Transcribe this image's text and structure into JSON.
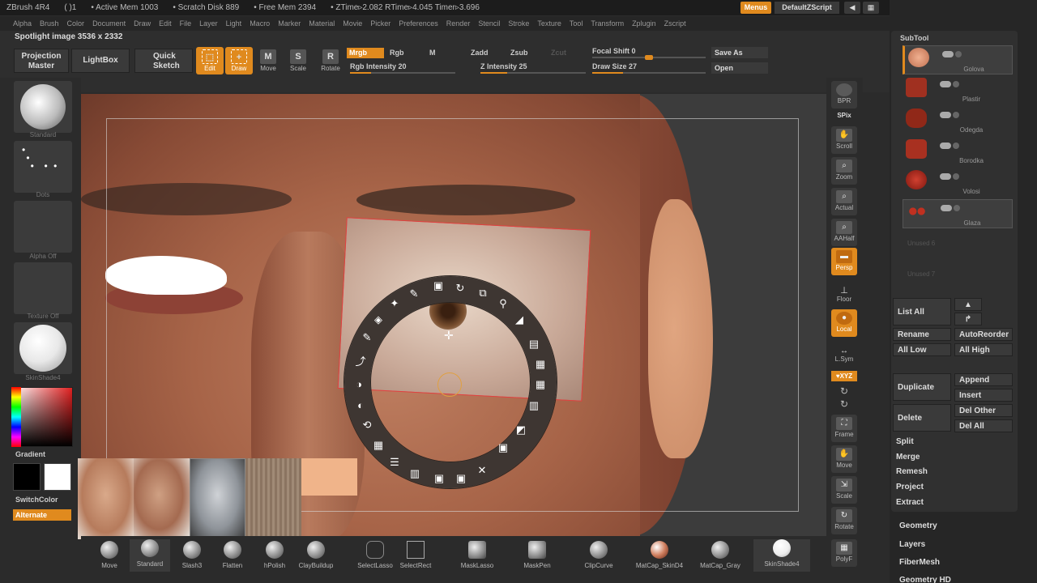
{
  "titlebar": {
    "app": "ZBrush 4R4",
    "paren": "( )1",
    "active_mem": "• Active Mem 1003",
    "scratch": "• Scratch Disk 889",
    "free_mem": "• Free Mem 2394",
    "ztime": "• ZTime▹2.082 RTime▹4.045 Timer▹3.696",
    "menus": "Menus",
    "default_script": "DefaultZScript"
  },
  "menubar": [
    "Alpha",
    "Brush",
    "Color",
    "Document",
    "Draw",
    "Edit",
    "File",
    "Layer",
    "Light",
    "Macro",
    "Marker",
    "Material",
    "Movie",
    "Picker",
    "Preferences",
    "Render",
    "Stencil",
    "Stroke",
    "Texture",
    "Tool",
    "Transform",
    "Zplugin",
    "Zscript"
  ],
  "toolbar": {
    "spotlight": "Spotlight image 3536 x 2332",
    "projection_master": "Projection Master",
    "lightbox": "LightBox",
    "quick_sketch": "Quick Sketch",
    "edit": "Edit",
    "draw": "Draw",
    "move": "Move",
    "scale": "Scale",
    "rotate": "Rotate",
    "mrgb": "Mrgb",
    "rgb": "Rgb",
    "m": "M",
    "rgb_intensity": "Rgb Intensity 20",
    "zadd": "Zadd",
    "zsub": "Zsub",
    "zcut": "Zcut",
    "z_intensity": "Z Intensity 25",
    "focal_shift": "Focal Shift 0",
    "draw_size": "Draw Size 27",
    "save_as": "Save As",
    "open": "Open",
    "rgb_intensity_value": 20,
    "z_intensity_value": 25,
    "focal_shift_value": 0,
    "draw_size_value": 27
  },
  "leftshelf": {
    "standard": "Standard",
    "dots": "Dots",
    "alpha": "Alpha Off",
    "texture": "Texture Off",
    "material": "SkinShade4",
    "gradient": "Gradient",
    "switchcolor": "SwitchColor",
    "alternate": "Alternate"
  },
  "rightdock": {
    "bpr": "BPR",
    "spix": "SPix",
    "scroll": "Scroll",
    "zoom": "Zoom",
    "actual": "Actual",
    "aahalf": "AAHalf",
    "persp": "Persp",
    "floor": "Floor",
    "local": "Local",
    "lsym": "L.Sym",
    "xyz": "♥XYZ",
    "frame": "Frame",
    "move": "Move",
    "scale": "Scale",
    "rotate": "Rotate",
    "polyf": "PolyF"
  },
  "subtool": {
    "title": "SubTool",
    "items": [
      "Golova",
      "Plastir",
      "Odegda",
      "Borodka",
      "Volosi",
      "Glaza"
    ],
    "empty": [
      "Unused 6",
      "Unused 7"
    ],
    "list_all": "List All",
    "rename": "Rename",
    "autoreorder": "AutoReorder",
    "all_low": "All Low",
    "all_high": "All High",
    "duplicate": "Duplicate",
    "append": "Append",
    "insert": "Insert",
    "delete": "Delete",
    "del_other": "Del Other",
    "del_all": "Del All",
    "split": "Split",
    "merge": "Merge",
    "remesh": "Remesh",
    "project": "Project",
    "extract": "Extract"
  },
  "sections": [
    "Geometry",
    "Layers",
    "FiberMesh",
    "Geometry HD"
  ],
  "brushes": [
    "Move",
    "Standard",
    "Slash3",
    "Flatten",
    "hPolish",
    "ClayBuildup",
    "SelectLasso",
    "SelectRect",
    "MaskLasso",
    "MaskPen",
    "ClipCurve",
    "MatCap_SkinD4",
    "MatCap_Gray",
    "SkinShade4"
  ],
  "colors": {
    "accent": "#e08a1e",
    "panel": "#2b2b2b"
  }
}
